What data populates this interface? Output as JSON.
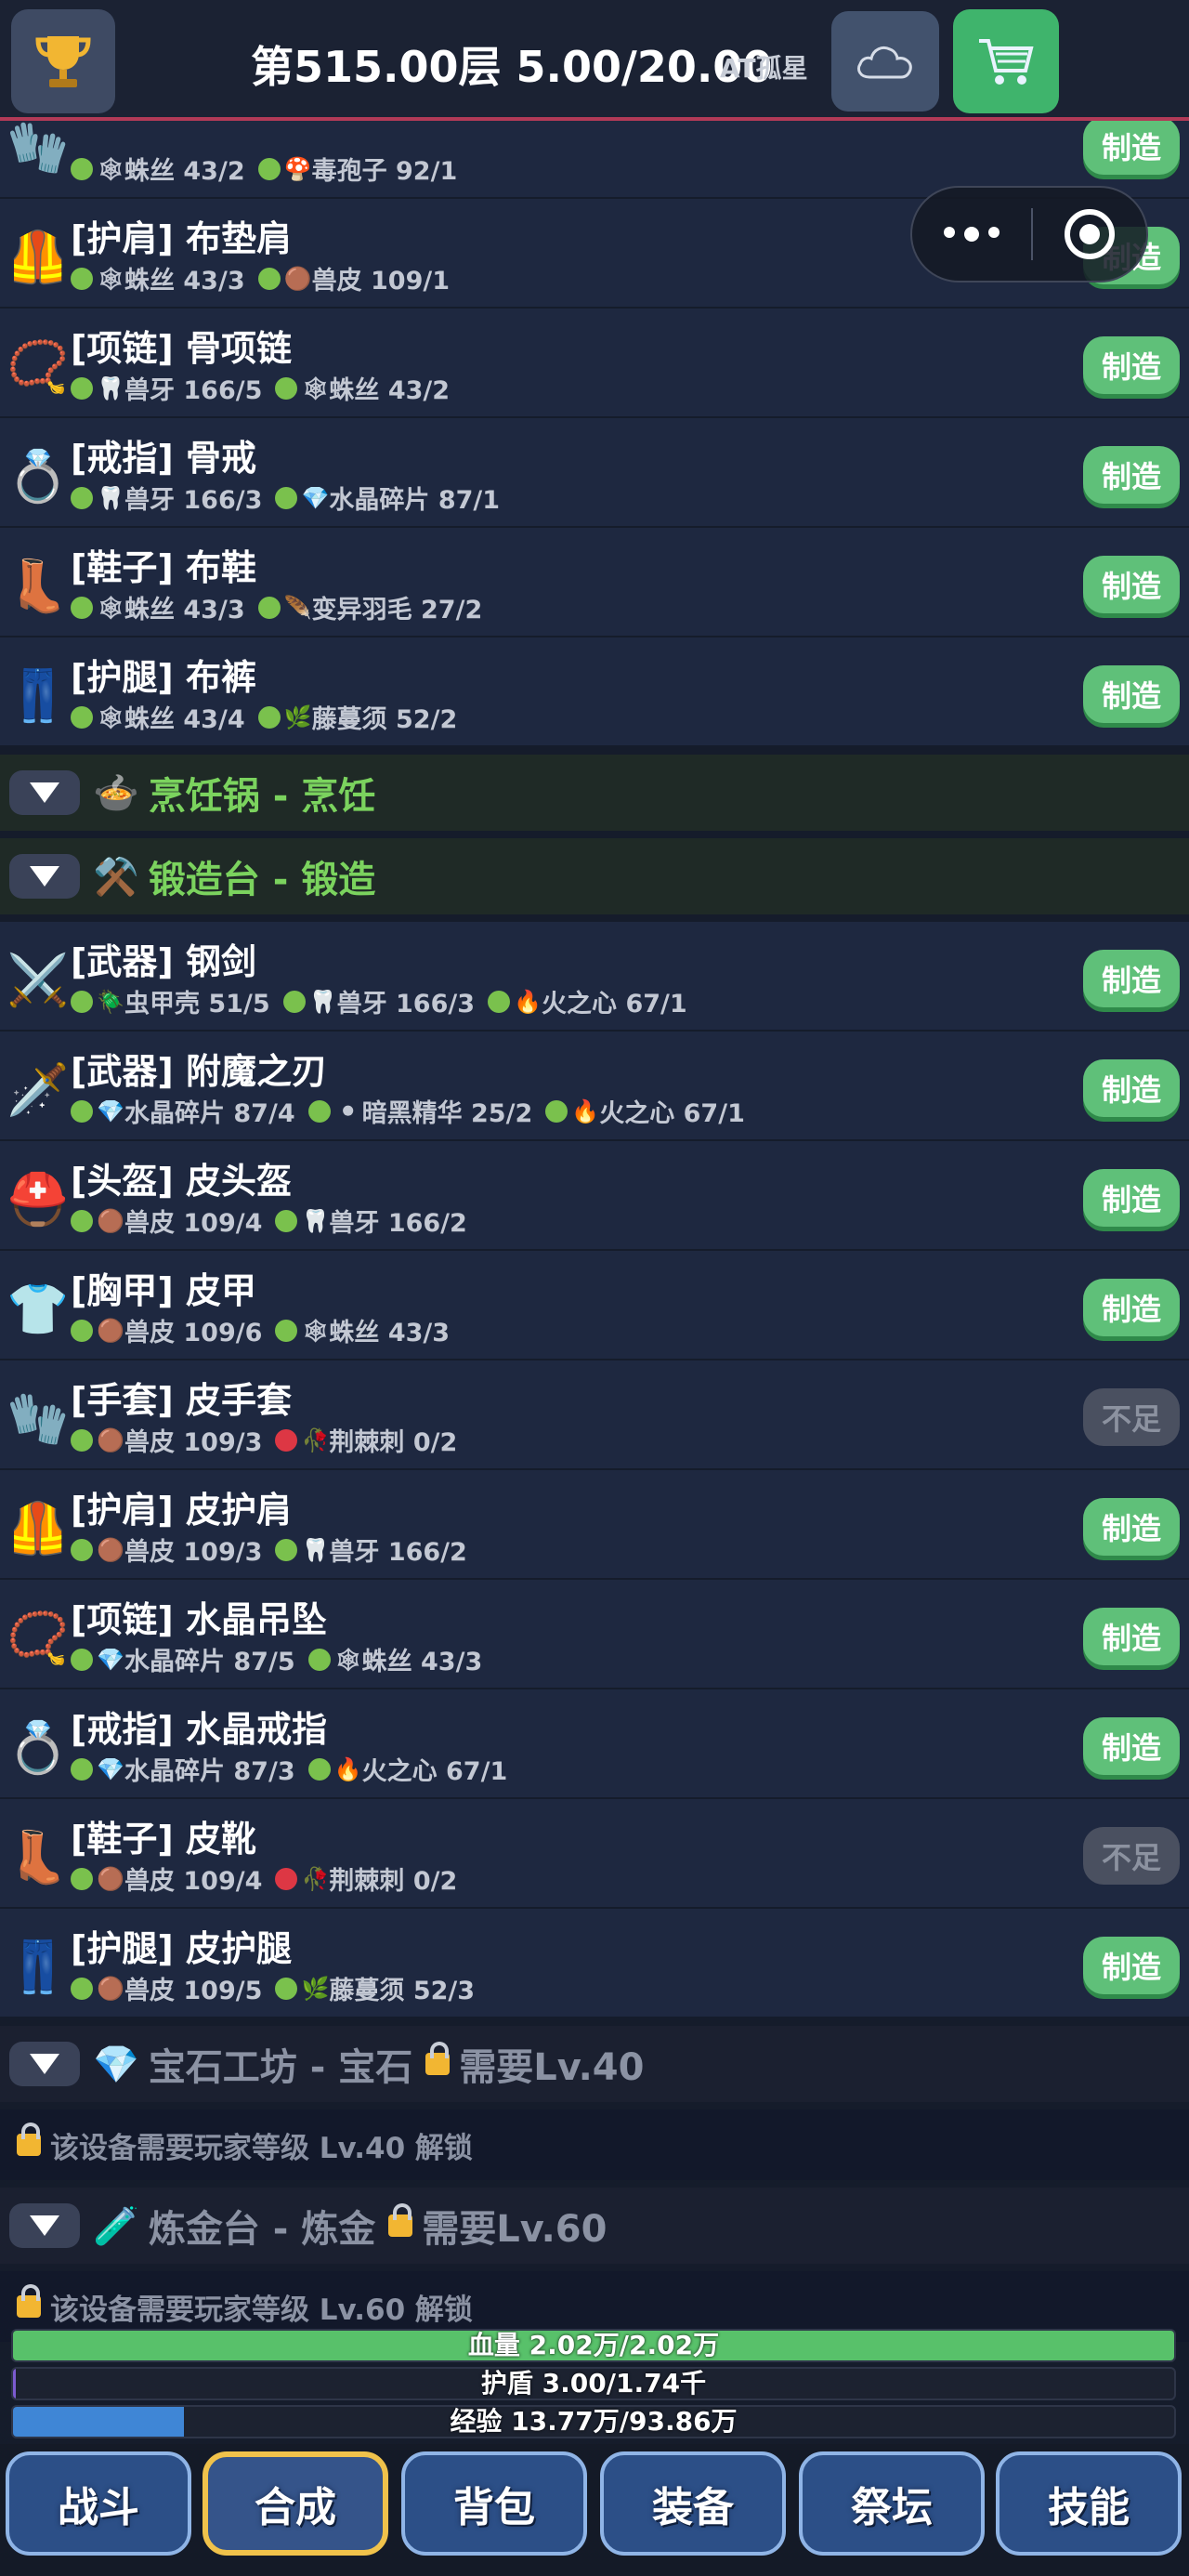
{
  "header": {
    "title": "第515.00层 5.00/20.00",
    "player": "AT孤星",
    "icons": {
      "trophy": "trophy-icon",
      "cloud": "cloud-icon",
      "cart": "cart-icon"
    }
  },
  "colors": {
    "accent": "#5fc079",
    "category_green": "#7bd35e",
    "header_border": "#b23a57"
  },
  "items_top": [
    {
      "name": "",
      "icon": "🧤",
      "mats": [
        {
          "dot": "g",
          "icon": "🕸",
          "text": "蛛丝 43/2"
        },
        {
          "dot": "g",
          "icon": "🍄",
          "text": "毒孢子 92/1"
        }
      ],
      "button": "制造",
      "ok": true
    },
    {
      "name": "[护肩] 布垫肩",
      "icon": "🦺",
      "mats": [
        {
          "dot": "g",
          "icon": "🕸",
          "text": "蛛丝 43/3"
        },
        {
          "dot": "g",
          "icon": "🟤",
          "text": "兽皮 109/1"
        }
      ],
      "button": "制造",
      "ok": true
    },
    {
      "name": "[项链] 骨项链",
      "icon": "📿",
      "mats": [
        {
          "dot": "g",
          "icon": "🦷",
          "text": "兽牙 166/5"
        },
        {
          "dot": "g",
          "icon": "🕸",
          "text": "蛛丝 43/2"
        }
      ],
      "button": "制造",
      "ok": true
    },
    {
      "name": "[戒指] 骨戒",
      "icon": "💍",
      "mats": [
        {
          "dot": "g",
          "icon": "🦷",
          "text": "兽牙 166/3"
        },
        {
          "dot": "g",
          "icon": "💎",
          "text": "水晶碎片 87/1"
        }
      ],
      "button": "制造",
      "ok": true
    },
    {
      "name": "[鞋子] 布鞋",
      "icon": "👢",
      "mats": [
        {
          "dot": "g",
          "icon": "🕸",
          "text": "蛛丝 43/3"
        },
        {
          "dot": "g",
          "icon": "🪶",
          "text": "变异羽毛 27/2"
        }
      ],
      "button": "制造",
      "ok": true
    },
    {
      "name": "[护腿] 布裤",
      "icon": "👖",
      "mats": [
        {
          "dot": "g",
          "icon": "🕸",
          "text": "蛛丝 43/4"
        },
        {
          "dot": "g",
          "icon": "🌿",
          "text": "藤蔓须 52/2"
        }
      ],
      "button": "制造",
      "ok": true
    }
  ],
  "cat_cooking": {
    "icon": "🍲",
    "title": "烹饪锅 - 烹饪"
  },
  "cat_forge": {
    "icon": "⚒️",
    "title": "锻造台 - 锻造"
  },
  "items_forge": [
    {
      "name": "[武器] 钢剑",
      "icon": "⚔️",
      "mats": [
        {
          "dot": "g",
          "icon": "🪲",
          "text": "虫甲壳 51/5"
        },
        {
          "dot": "g",
          "icon": "🦷",
          "text": "兽牙 166/3"
        },
        {
          "dot": "g",
          "icon": "🔥",
          "text": "火之心 67/1"
        }
      ],
      "button": "制造",
      "ok": true
    },
    {
      "name": "[武器] 附魔之刃",
      "icon": "🗡️",
      "mats": [
        {
          "dot": "g",
          "icon": "💎",
          "text": "水晶碎片 87/4"
        },
        {
          "dot": "g",
          "icon": "⚫",
          "text": "暗黑精华 25/2"
        },
        {
          "dot": "g",
          "icon": "🔥",
          "text": "火之心 67/1"
        }
      ],
      "button": "制造",
      "ok": true
    },
    {
      "name": "[头盔] 皮头盔",
      "icon": "⛑️",
      "mats": [
        {
          "dot": "g",
          "icon": "🟤",
          "text": "兽皮 109/4"
        },
        {
          "dot": "g",
          "icon": "🦷",
          "text": "兽牙 166/2"
        }
      ],
      "button": "制造",
      "ok": true
    },
    {
      "name": "[胸甲] 皮甲",
      "icon": "👕",
      "mats": [
        {
          "dot": "g",
          "icon": "🟤",
          "text": "兽皮 109/6"
        },
        {
          "dot": "g",
          "icon": "🕸",
          "text": "蛛丝 43/3"
        }
      ],
      "button": "制造",
      "ok": true
    },
    {
      "name": "[手套] 皮手套",
      "icon": "🧤",
      "mats": [
        {
          "dot": "g",
          "icon": "🟤",
          "text": "兽皮 109/3"
        },
        {
          "dot": "r",
          "icon": "🥀",
          "text": "荆棘刺 0/2"
        }
      ],
      "button": "不足",
      "ok": false
    },
    {
      "name": "[护肩] 皮护肩",
      "icon": "🦺",
      "mats": [
        {
          "dot": "g",
          "icon": "🟤",
          "text": "兽皮 109/3"
        },
        {
          "dot": "g",
          "icon": "🦷",
          "text": "兽牙 166/2"
        }
      ],
      "button": "制造",
      "ok": true
    },
    {
      "name": "[项链] 水晶吊坠",
      "icon": "📿",
      "mats": [
        {
          "dot": "g",
          "icon": "💎",
          "text": "水晶碎片 87/5"
        },
        {
          "dot": "g",
          "icon": "🕸",
          "text": "蛛丝 43/3"
        }
      ],
      "button": "制造",
      "ok": true
    },
    {
      "name": "[戒指] 水晶戒指",
      "icon": "💍",
      "mats": [
        {
          "dot": "g",
          "icon": "💎",
          "text": "水晶碎片 87/3"
        },
        {
          "dot": "g",
          "icon": "🔥",
          "text": "火之心 67/1"
        }
      ],
      "button": "制造",
      "ok": true
    },
    {
      "name": "[鞋子] 皮靴",
      "icon": "👢",
      "mats": [
        {
          "dot": "g",
          "icon": "🟤",
          "text": "兽皮 109/4"
        },
        {
          "dot": "r",
          "icon": "🥀",
          "text": "荆棘刺 0/2"
        }
      ],
      "button": "不足",
      "ok": false
    },
    {
      "name": "[护腿] 皮护腿",
      "icon": "👖",
      "mats": [
        {
          "dot": "g",
          "icon": "🟤",
          "text": "兽皮 109/5"
        },
        {
          "dot": "g",
          "icon": "🌿",
          "text": "藤蔓须 52/3"
        }
      ],
      "button": "制造",
      "ok": true
    }
  ],
  "cat_gem": {
    "icon": "💎",
    "title": "宝石工坊 - 宝石",
    "req": "需要Lv.40",
    "msg": "该设备需要玩家等级 Lv.40 解锁"
  },
  "cat_alchemy": {
    "icon": "🧪",
    "title": "炼金台 - 炼金",
    "req": "需要Lv.60",
    "msg": "该设备需要玩家等级 Lv.60 解锁"
  },
  "bars": {
    "hp": {
      "label": "血量 2.02万/2.02万",
      "fraction": 1.0,
      "color": "#58c16a"
    },
    "shield": {
      "label": "护盾 3.00/1.74千",
      "fraction": 0.002,
      "color": "#7b5bd0"
    },
    "exp": {
      "label": "经验 13.77万/93.86万",
      "fraction": 0.147,
      "color": "#3f86d6"
    }
  },
  "nav": [
    "战斗",
    "合成",
    "背包",
    "装备",
    "祭坛",
    "技能"
  ],
  "nav_active": 1
}
